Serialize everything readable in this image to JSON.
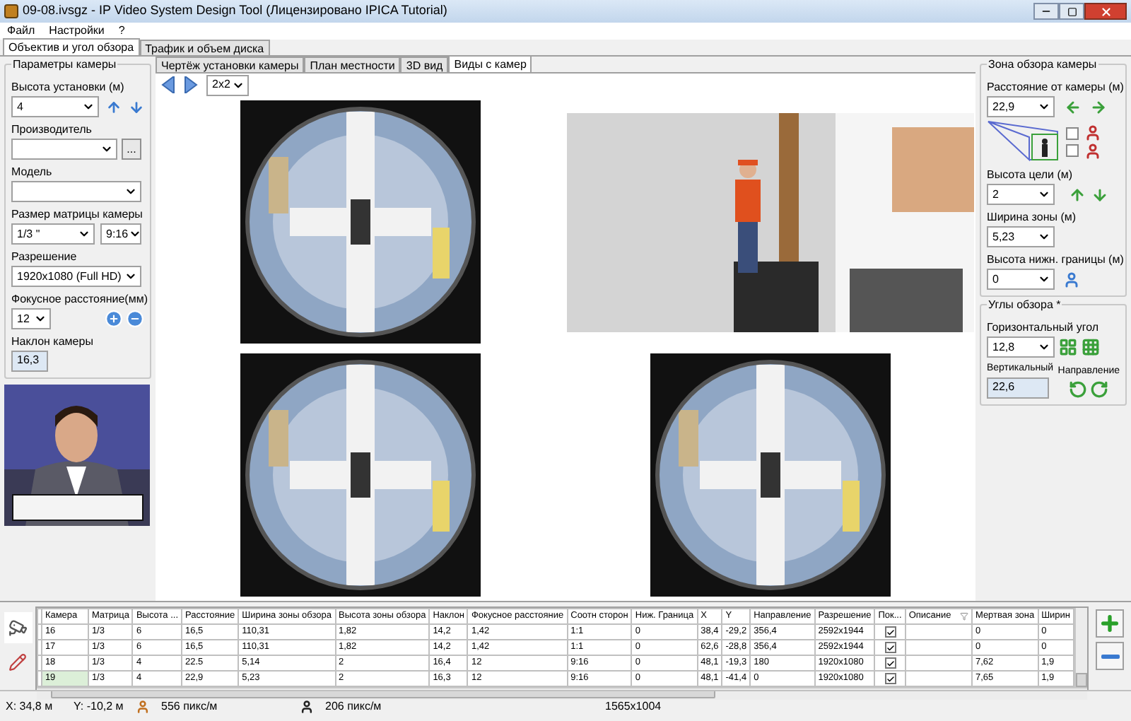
{
  "window": {
    "title": "09-08.ivsgz - IP Video System Design Tool (Лицензировано  IPICA Tutorial)"
  },
  "menu": [
    "Файл",
    "Настройки",
    "?"
  ],
  "main_tabs": [
    {
      "label": "Объектив и угол обзора",
      "selected": true
    },
    {
      "label": "Трафик и объем диска",
      "selected": false
    }
  ],
  "camera_params": {
    "title": "Параметры камеры",
    "mount_height": {
      "label": "Высота установки (м)",
      "value": "4"
    },
    "manufacturer": {
      "label": "Производитель",
      "browse": "..."
    },
    "model": {
      "label": "Модель"
    },
    "matrix": {
      "label": "Размер матрицы камеры",
      "size": "1/3 \"",
      "aspect": "9:16"
    },
    "resolution": {
      "label": "Разрешение",
      "value": "1920x1080 (Full HD)"
    },
    "focal": {
      "label": "Фокусное расстояние(мм)",
      "value": "12"
    },
    "tilt": {
      "label": "Наклон камеры",
      "value": "16,3"
    }
  },
  "view_tabs": [
    {
      "label": "Чертёж установки камеры",
      "selected": false
    },
    {
      "label": "План местности",
      "selected": false
    },
    {
      "label": "3D вид",
      "selected": false
    },
    {
      "label": "Виды с камер",
      "selected": true
    }
  ],
  "layout_select": "2x2",
  "view_zone": {
    "title": "Зона обзора камеры",
    "distance": {
      "label": "Расстояние от камеры (м)",
      "value": "22,9"
    },
    "checkboxes": [
      {
        "checked": false
      },
      {
        "checked": false
      }
    ],
    "target_height": {
      "label": "Высота цели (м)",
      "value": "2"
    },
    "zone_width": {
      "label": "Ширина зоны (м)",
      "value": "5,23"
    },
    "lower_bound": {
      "label": "Высота нижн. границы (м)",
      "value": "0"
    }
  },
  "angles": {
    "title": "Углы обзора *",
    "horizontal": {
      "label": "Горизонтальный угол",
      "value": "12,8"
    },
    "vertical": {
      "label": "Вертикальный",
      "value": "22,6"
    },
    "direction": "Направление"
  },
  "table": {
    "columns": [
      "Камера",
      "Матрица",
      "Высота ...",
      "Расстояние",
      "Ширина зоны обзора",
      "Высота зоны обзора",
      "Наклон",
      "Фокусное расстояние",
      "Соотн сторон",
      "Ниж. Граница",
      "X",
      "Y",
      "Направление",
      "Разрешение",
      "Пок...",
      "Описание",
      "Мертвая зона",
      "Ширин"
    ],
    "rows": [
      {
        "selected": false,
        "cells": [
          "16",
          "1/3",
          "6",
          "16,5",
          "110,31",
          "1,82",
          "14,2",
          "1,42",
          "1:1",
          "0",
          "38,4",
          "-29,2",
          "356,4",
          "2592x1944"
        ],
        "shown": true,
        "tail": [
          "0",
          "0"
        ]
      },
      {
        "selected": false,
        "cells": [
          "17",
          "1/3",
          "6",
          "16,5",
          "110,31",
          "1,82",
          "14,2",
          "1,42",
          "1:1",
          "0",
          "62,6",
          "-28,8",
          "356,4",
          "2592x1944"
        ],
        "shown": true,
        "tail": [
          "0",
          "0"
        ]
      },
      {
        "selected": false,
        "cells": [
          "18",
          "1/3",
          "4",
          "22.5",
          "5,14",
          "2",
          "16,4",
          "12",
          "9:16",
          "0",
          "48,1",
          "-19,3",
          "180",
          "1920x1080"
        ],
        "shown": true,
        "tail": [
          "7,62",
          "1,9"
        ]
      },
      {
        "selected": true,
        "cells": [
          "19",
          "1/3",
          "4",
          "22,9",
          "5,23",
          "2",
          "16,3",
          "12",
          "9:16",
          "0",
          "48,1",
          "-41,4",
          "0",
          "1920x1080"
        ],
        "shown": true,
        "tail": [
          "7,65",
          "1,9"
        ]
      }
    ]
  },
  "status_bar": {
    "x": "X: 34,8 м",
    "y": "Y: -10,2 м",
    "density_1": "556 пикс/м",
    "density_2": "206 пикс/м",
    "size": "1565x1004"
  }
}
